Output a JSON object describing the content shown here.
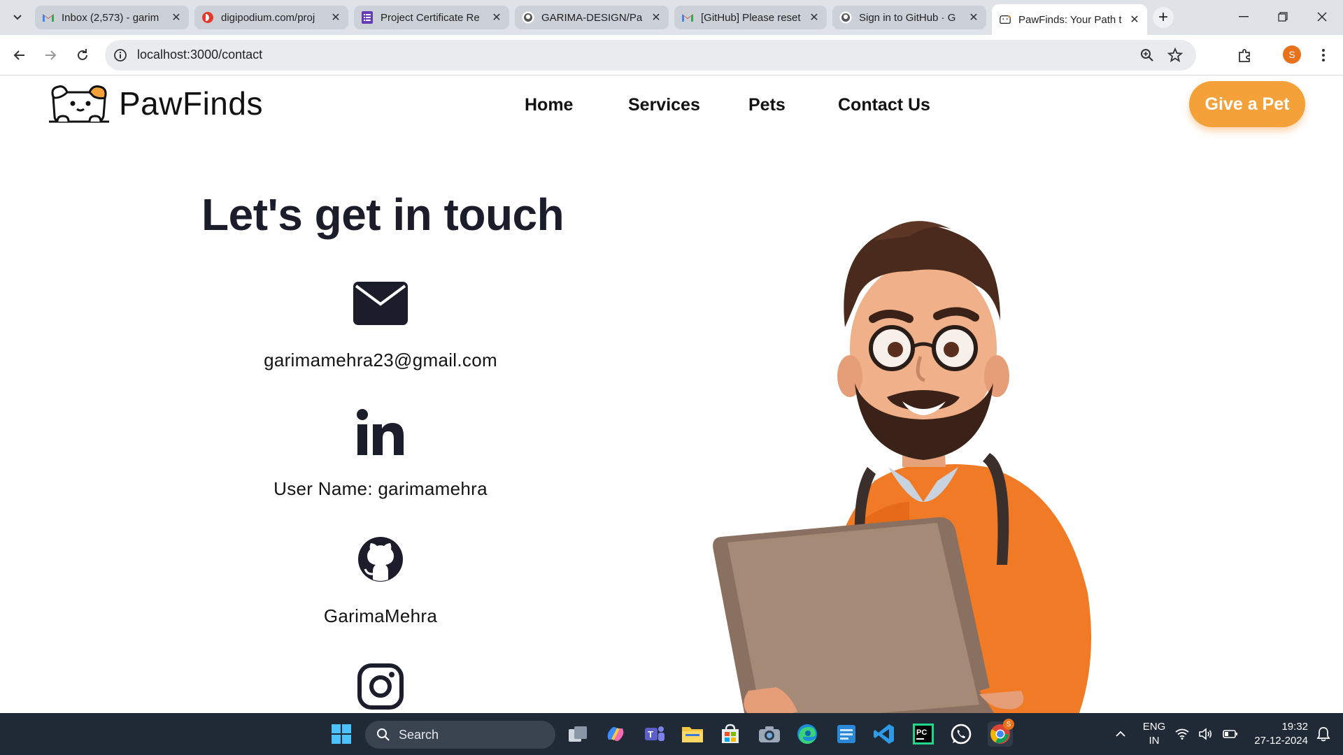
{
  "browser": {
    "tabs": [
      {
        "title": "Inbox (2,573) - garim",
        "icon": "gmail-icon"
      },
      {
        "title": "digipodium.com/proj",
        "icon": "digipodium-icon"
      },
      {
        "title": "Project Certificate Re",
        "icon": "forms-icon"
      },
      {
        "title": "GARIMA-DESIGN/Pa",
        "icon": "github-icon"
      },
      {
        "title": "[GitHub] Please reset",
        "icon": "gmail-icon"
      },
      {
        "title": "Sign in to GitHub · G",
        "icon": "github-icon"
      },
      {
        "title": "PawFinds: Your Path t",
        "icon": "pawfinds-icon",
        "active": true
      }
    ],
    "url": "localhost:3000/contact",
    "profile_initial": "S"
  },
  "site": {
    "logo_text": "PawFinds",
    "nav": [
      "Home",
      "Services",
      "Pets",
      "Contact Us"
    ],
    "cta_label": "Give a Pet",
    "accent_color": "#f5a13a"
  },
  "contact": {
    "heading": "Let's get in touch",
    "items": [
      {
        "icon": "envelope-icon",
        "text": "garimamehra23@gmail.com"
      },
      {
        "icon": "linkedin-icon",
        "text": "User Name: garimamehra"
      },
      {
        "icon": "github-icon",
        "text": "GarimaMehra"
      },
      {
        "icon": "instagram-icon",
        "text": ""
      }
    ]
  },
  "taskbar": {
    "search_label": "Search",
    "lang_line1": "ENG",
    "lang_line2": "IN",
    "time": "19:32",
    "date": "27-12-2024",
    "chrome_badge": "S"
  }
}
